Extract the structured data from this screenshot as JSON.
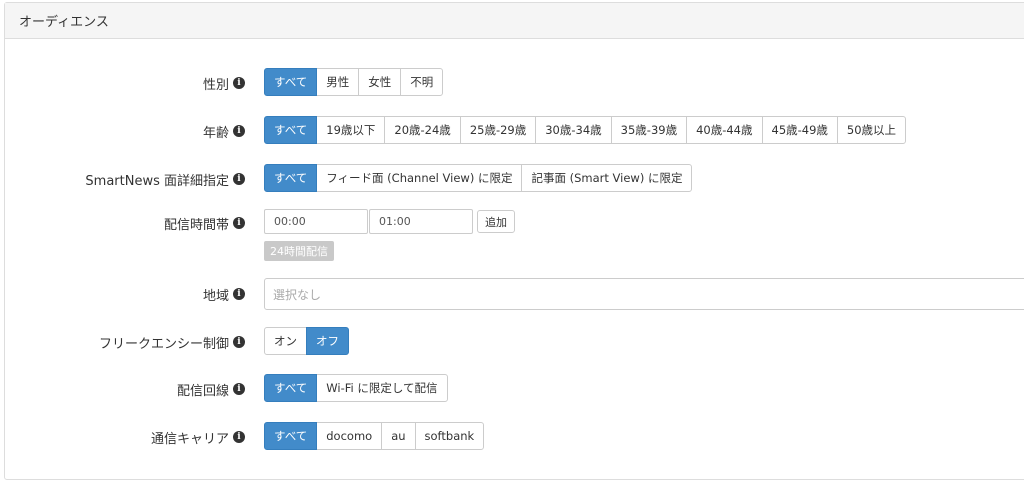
{
  "panel": {
    "title": "オーディエンス"
  },
  "gender": {
    "label": "性別",
    "options": [
      "すべて",
      "男性",
      "女性",
      "不明"
    ],
    "selected": "すべて"
  },
  "age": {
    "label": "年齢",
    "options": [
      "すべて",
      "19歳以下",
      "20歳-24歳",
      "25歳-29歳",
      "30歳-34歳",
      "35歳-39歳",
      "40歳-44歳",
      "45歳-49歳",
      "50歳以上"
    ],
    "selected": "すべて"
  },
  "smartnews": {
    "label": "SmartNews 面詳細指定",
    "options": [
      "すべて",
      "フィード面 (Channel View) に限定",
      "記事面 (Smart View) に限定"
    ],
    "selected": "すべて"
  },
  "schedule": {
    "label": "配信時間帯",
    "start_placeholder": "00:00",
    "end_placeholder": "01:00",
    "add_label": "追加",
    "tag_label": "24時間配信"
  },
  "region": {
    "label": "地域",
    "placeholder": "選択なし"
  },
  "frequency": {
    "label": "フリークエンシー制御",
    "options": [
      "オン",
      "オフ"
    ],
    "selected": "オフ"
  },
  "line": {
    "label": "配信回線",
    "options": [
      "すべて",
      "Wi-Fi に限定して配信"
    ],
    "selected": "すべて"
  },
  "carrier": {
    "label": "通信キャリア",
    "options": [
      "すべて",
      "docomo",
      "au",
      "softbank"
    ],
    "selected": "すべて"
  },
  "colors": {
    "accent": "#428bca",
    "border": "#cccccc",
    "tag": "#c9c9c9"
  },
  "icons": {
    "info": "info-circle-icon"
  }
}
